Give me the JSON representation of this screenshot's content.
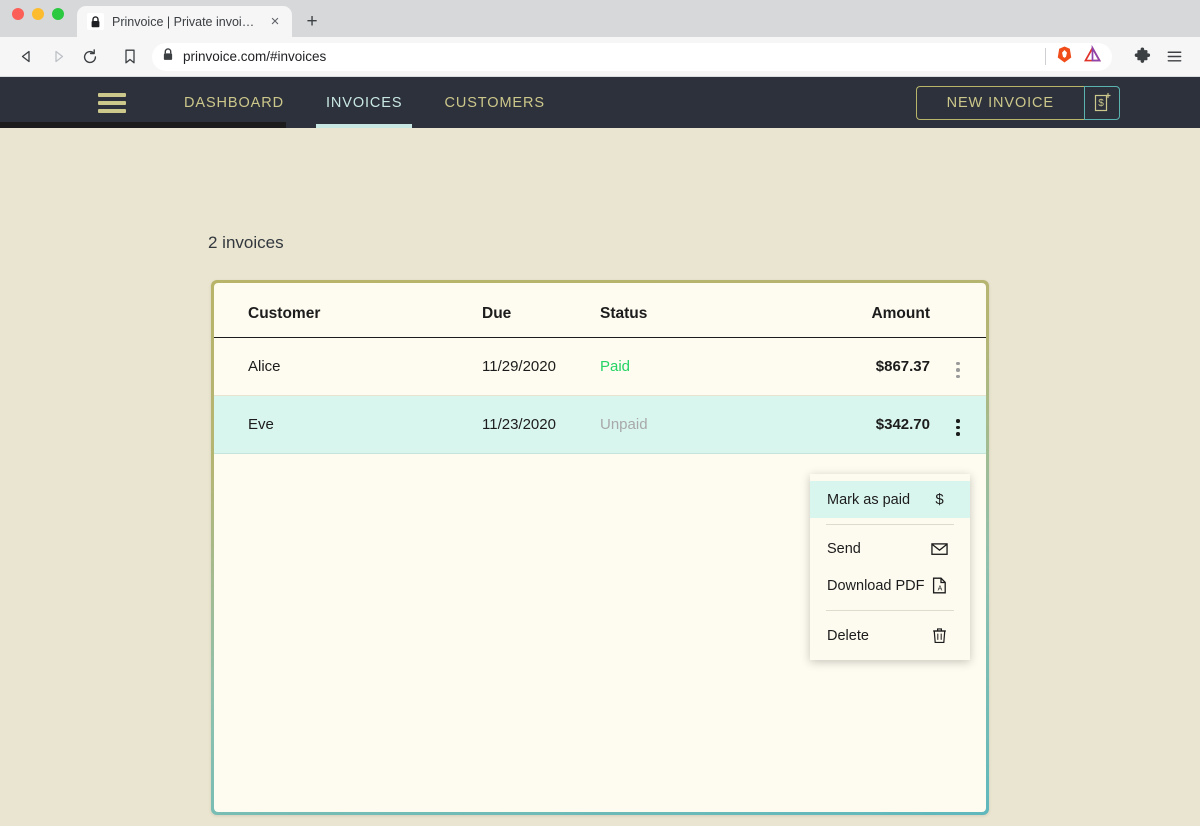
{
  "browser": {
    "window_controls": [
      "close",
      "minimize",
      "maximize"
    ],
    "tab": {
      "title": "Prinvoice | Private invoicing",
      "favicon": "lock-icon",
      "close_label": "×"
    },
    "new_tab_label": "+",
    "toolbar": {
      "back_label": "◁",
      "forward_label": "▷",
      "reload_label": "⟳",
      "bookmark_label": "bookmark-icon",
      "url": "prinvoice.com/#invoices",
      "site_security": "lock-icon",
      "brave_shield": "brave-lion-icon",
      "extension_triangle": "triangle-icon",
      "extensions_label": "puzzle-icon",
      "menu_label": "☰"
    }
  },
  "app": {
    "nav": {
      "menu_icon": "hamburger-icon",
      "links": [
        {
          "label": "DASHBOARD",
          "active": false
        },
        {
          "label": "INVOICES",
          "active": true
        },
        {
          "label": "CUSTOMERS",
          "active": false
        }
      ],
      "new_invoice": {
        "label": "NEW INVOICE",
        "icon": "document-dollar-plus-icon"
      }
    },
    "page": {
      "count_label": "2 invoices",
      "table": {
        "headers": [
          "Customer",
          "Due",
          "Status",
          "Amount"
        ],
        "rows": [
          {
            "customer": "Alice",
            "due": "11/29/2020",
            "status": "Paid",
            "status_type": "paid",
            "amount": "$867.37",
            "highlighted": false
          },
          {
            "customer": "Eve",
            "due": "11/23/2020",
            "status": "Unpaid",
            "status_type": "unpaid",
            "amount": "$342.70",
            "highlighted": true
          }
        ]
      },
      "context_menu": {
        "items": [
          {
            "label": "Mark as paid",
            "icon": "dollar-icon",
            "active": true
          },
          {
            "label": "Send",
            "icon": "envelope-icon",
            "active": false
          },
          {
            "label": "Download PDF",
            "icon": "pdf-file-icon",
            "active": false
          },
          {
            "label": "Delete",
            "icon": "trash-icon",
            "active": false
          }
        ]
      }
    }
  },
  "colors": {
    "page_background": "#eae5d0",
    "navbar": "#2d313c",
    "nav_link": "#ccc78a",
    "nav_link_active": "#c8e7e2",
    "card_background": "#fefcf0",
    "card_border_top": "#b8b46a",
    "card_border_bottom": "#5fb8bc",
    "row_highlight": "#d9f6ee",
    "status_paid": "#25d366",
    "status_unpaid": "#a8a8a8"
  }
}
